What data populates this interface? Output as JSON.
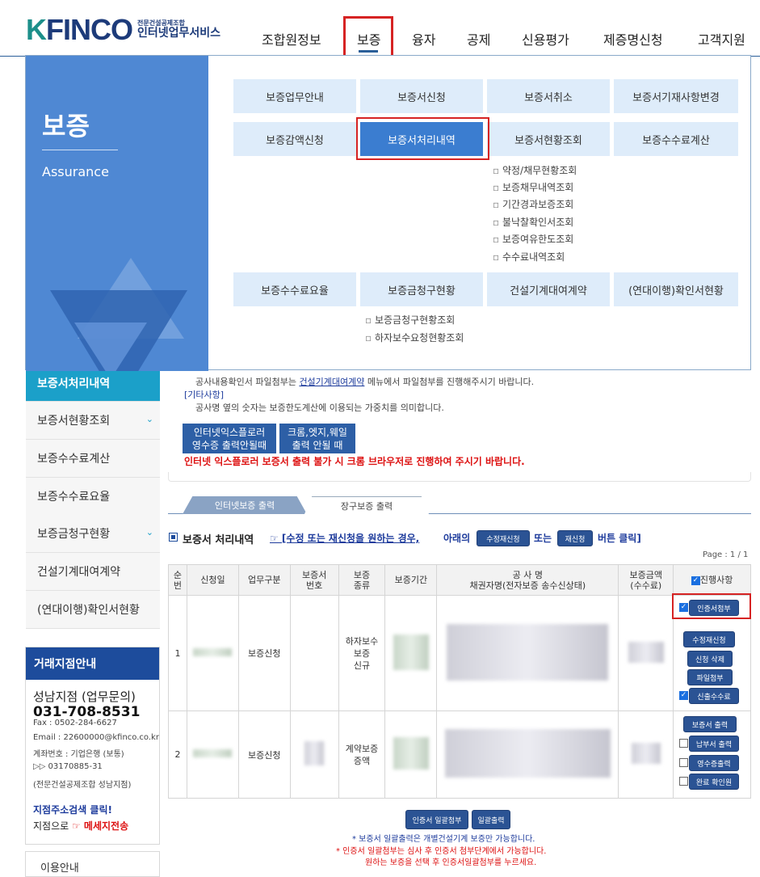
{
  "header": {
    "logo_k": "K",
    "logo_finco": "FINCO",
    "logo_sub1": "전문건설공제조합",
    "logo_sub2": "인터넷업무서비스",
    "gnb": [
      "조합원정보",
      "보증",
      "융자",
      "공제",
      "신용평가",
      "제증명신청",
      "고객지원"
    ]
  },
  "mega": {
    "title": "보증",
    "subtitle": "Assurance",
    "row1": [
      "보증업무안내",
      "보증서신청",
      "보증서취소",
      "보증서기재사항변경"
    ],
    "row2": [
      "보증감액신청",
      "보증서처리내역",
      "보증서현황조회",
      "보증수수료계산"
    ],
    "sub_col3": [
      "약정/채무현황조회",
      "보증채무내역조회",
      "기간경과보증조회",
      "불낙찰확인서조회",
      "보증여유한도조회",
      "수수료내역조회"
    ],
    "row3": [
      "보증수수료요율",
      "보증금청구현황",
      "건설기계대여계약",
      "(연대이행)확인서현황"
    ],
    "sub_col2": [
      "보증금청구현황조회",
      "하자보수요청현황조회"
    ]
  },
  "left_nav": {
    "items": [
      {
        "label": "보증서처리내역",
        "active": true,
        "chev": false
      },
      {
        "label": "보증서현황조회",
        "active": false,
        "chev": true
      },
      {
        "label": "보증수수료계산",
        "active": false,
        "chev": false
      },
      {
        "label": "보증수수료요율",
        "active": false,
        "chev": false
      },
      {
        "label": "보증금청구현황",
        "active": false,
        "chev": true
      },
      {
        "label": "건설기계대여계약",
        "active": false,
        "chev": false
      },
      {
        "label": "(연대이행)확인서현황",
        "active": false,
        "chev": false
      }
    ],
    "chev_icon": "⌄"
  },
  "branch": {
    "head": "거래지점안내",
    "name": "성남지점 (업무문의)",
    "tel": "031-708-8531",
    "fax": "Fax : 0502-284-6627",
    "email": "Email : 22600000@kfinco.co.kr",
    "account_bank": "계좌번호 : 기업은행 (보통)",
    "account_no": "▷▷ 03170885-31",
    "account_owner": "(전문건설공제조합 성남지점)",
    "search_link": "지점주소검색 클릭!",
    "msg_prefix": "지점으로",
    "msg_link": "☞ 메세지전송"
  },
  "usage": "이용안내",
  "notices": {
    "line1_pre": "공사내용확인서 파일첨부는 ",
    "line1_link": "건설기계대여계약",
    "line1_post": " 메뉴에서 파일첨부를 진행해주시기 바랍니다.",
    "etc_label": "[기타사항]",
    "etc_text": "공사명 옆의 숫자는 보증한도계산에 이용되는 가중치를 의미합니다.",
    "ie_button_l1": "인터넷익스플로러",
    "ie_button_l2": "영수증 출력안될때",
    "chrome_button_l1": "크롬,엣지,웨일",
    "chrome_button_l2": "출력 안될 때",
    "red_notice": "인터넷 익스플로러 보증서 출력 불가 시 크롬 브라우저로 진행하여 주시기 바랍니다."
  },
  "tabs": [
    "인터넷보증 출력",
    "장구보증 출력"
  ],
  "list_section": {
    "title": "보증서 처리내역",
    "hint_link": "☞ [수정 또는 재신청을 원하는 경우,",
    "hint_mid": "아래의",
    "btn_modify": "수정재신청",
    "hint_or": "또는",
    "btn_reapply": "재신청",
    "hint_end": "버튼 클릭]",
    "page": "Page : 1 / 1"
  },
  "table": {
    "headers": [
      "순\n번",
      "신청일",
      "업무구분",
      "보증서\n번호",
      "보증\n종류",
      "보증기간",
      "공 사 명\n채권자명(전자보증 송수신상태)",
      "보증금액\n(수수료)",
      "진행사항"
    ],
    "rows": [
      {
        "no": "1",
        "type": "보증신청",
        "kind": "하자보수\n보증\n신규",
        "actions": [
          {
            "label": "인증서첨부",
            "checkbox": true,
            "checked": true
          },
          {
            "label": "수정재신청",
            "checkbox": false
          },
          {
            "label": "신청 삭제",
            "checkbox": false
          },
          {
            "label": "파일첨부",
            "checkbox": false
          },
          {
            "label": "신출수수료",
            "checkbox": true,
            "checked": true
          }
        ]
      },
      {
        "no": "2",
        "type": "보증신청",
        "kind": "계약보증\n증액",
        "actions": [
          {
            "label": "보증서 출력",
            "checkbox": false
          },
          {
            "label": "납부서 출력",
            "checkbox": true,
            "checked": false
          },
          {
            "label": "영수증출력",
            "checkbox": true,
            "checked": false
          },
          {
            "label": "완료 확인원",
            "checkbox": true,
            "checked": false
          }
        ]
      }
    ]
  },
  "bottom": {
    "btn_attach_all": "인증서 일괄첨부",
    "btn_print_all": "일괄출력",
    "note1": "* 보증서 일괄출력은 개별건설기계 보증만 가능합니다.",
    "note2": "* 인증서 일괄첨부는 심사 후 인증서 첨부단계에서 가능합니다.",
    "note3": "원하는 보증을 선택 후 인증서일괄첨부를 누르세요."
  },
  "colors": {
    "accent": "#2d5fa6",
    "highlight": "#d62323",
    "mega_side": "#4f88d3",
    "nav_active": "#1ba0c9"
  }
}
